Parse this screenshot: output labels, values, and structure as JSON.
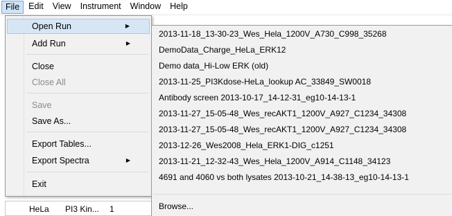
{
  "menubar": {
    "items": [
      "File",
      "Edit",
      "View",
      "Instrument",
      "Window",
      "Help"
    ]
  },
  "file_menu": {
    "items": [
      {
        "label": "Open Run",
        "submenu": true,
        "disabled": false
      },
      {
        "label": "Add Run",
        "submenu": true,
        "disabled": false
      },
      {
        "label": "Close",
        "submenu": false,
        "disabled": false
      },
      {
        "label": "Close All",
        "submenu": false,
        "disabled": true
      },
      {
        "label": "Save",
        "submenu": false,
        "disabled": true
      },
      {
        "label": "Save As...",
        "submenu": false,
        "disabled": false
      },
      {
        "label": "Export Tables...",
        "submenu": false,
        "disabled": false
      },
      {
        "label": "Export Spectra",
        "submenu": true,
        "disabled": false
      },
      {
        "label": "Exit",
        "submenu": false,
        "disabled": false
      }
    ],
    "arrow_glyph": "▶"
  },
  "open_run_submenu": {
    "items": [
      "2013-11-18_13-30-23_Wes_Hela_1200V_A730_C998_35268",
      "DemoData_Charge_HeLa_ERK12",
      "Demo data_Hi-Low ERK (old)",
      "2013-11-25_PI3Kdose-HeLa_lookup AC_33849_SW0018",
      "Antibody screen 2013-10-17_14-12-31_eg10-14-13-1",
      "2013-11-27_15-05-48_Wes_recAKT1_1200V_A927_C1234_34308",
      "2013-11-27_15-05-48_Wes_recAKT1_1200V_A927_C1234_34308",
      "2013-12-26_Wes2008_Hela_ERK1-DIG_c1251",
      "2013-11-21_12-32-43_Wes_Hela_1200V_A914_C1148_34123",
      "4691 and 4060 vs both lysates 2013-10-21_14-38-13_eg10-14-13-1"
    ],
    "browse_label": "Browse..."
  },
  "underlying_table": {
    "cells": [
      "HeLa",
      "PI3 Kin...",
      "1"
    ]
  },
  "colors": {
    "highlight": "#d7e6f5",
    "menu_bg": "#f1f1f1",
    "disabled_text": "#8a8a8a"
  }
}
